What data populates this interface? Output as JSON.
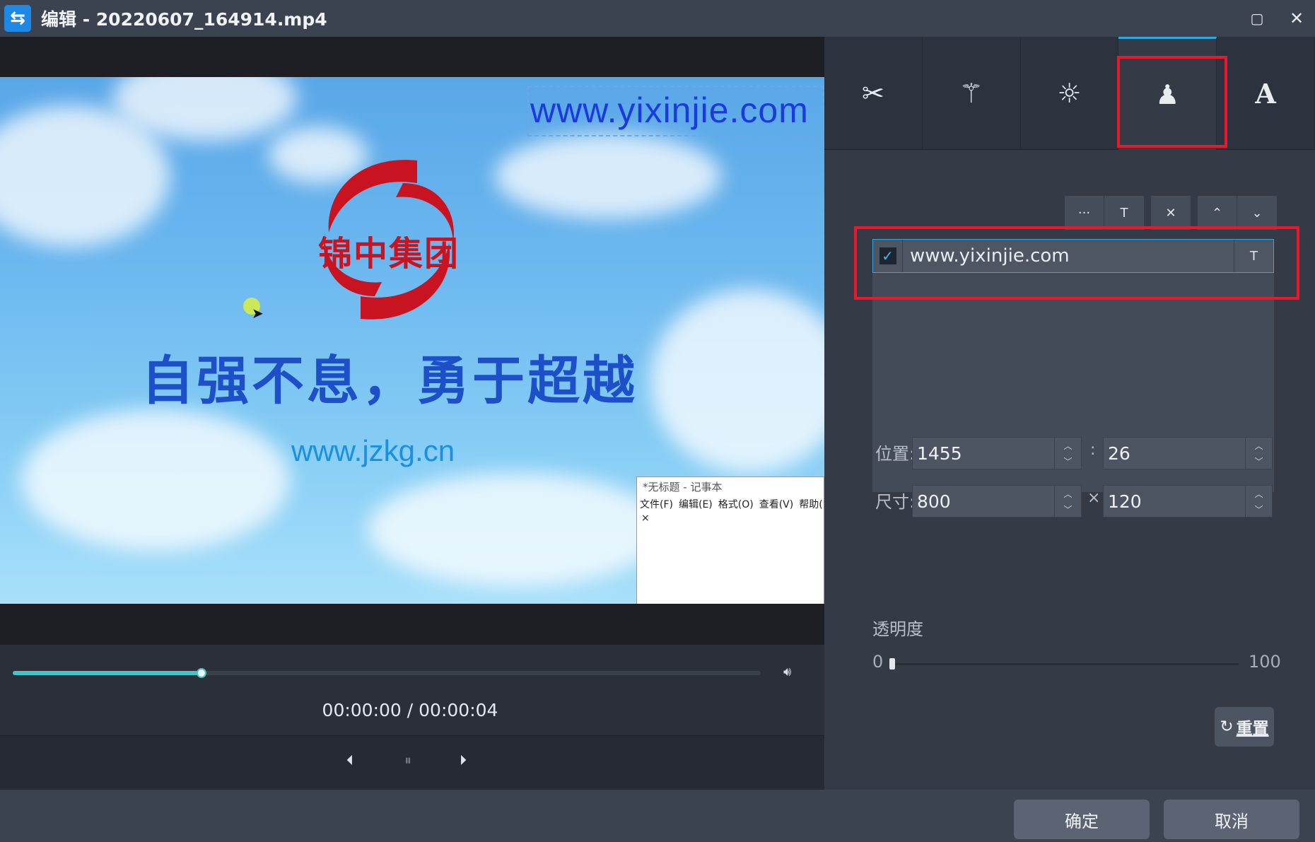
{
  "window": {
    "title": "编辑 - 20220607_164914.mp4",
    "maximize_glyph": "▢",
    "close_glyph": "✕"
  },
  "video": {
    "watermark_text": "www.yixinjie.com",
    "logo_text": "锦中集团",
    "slogan": "自强不息，勇于超越",
    "site_text": "www.jzkg.cn",
    "notepad": {
      "title": "*无标题 - 记事本",
      "menu": [
        "文件(F)",
        "编辑(E)",
        "格式(O)",
        "查看(V)",
        "帮助(H)"
      ],
      "content": "×"
    }
  },
  "player": {
    "progress": 0.252,
    "time": "00:00:00 / 00:00:04",
    "volume_icon": "speaker-icon"
  },
  "tabs": [
    {
      "name": "cut",
      "icon": "scissors-icon",
      "glyph": "✂"
    },
    {
      "name": "effects",
      "icon": "magic-wand-icon",
      "glyph": "⚚"
    },
    {
      "name": "adjust",
      "icon": "brightness-icon",
      "glyph": "☼"
    },
    {
      "name": "watermark",
      "icon": "stamp-icon",
      "glyph": "♟",
      "active": true
    },
    {
      "name": "text",
      "icon": "text-icon",
      "glyph": "A"
    }
  ],
  "toolbar": {
    "more": "···",
    "text": "T",
    "delete": "✕",
    "up": "⌃",
    "down": "⌄"
  },
  "watermarks": [
    {
      "text": "www.yixinjie.com",
      "checked": true,
      "type_glyph": "T"
    }
  ],
  "position": {
    "label": "位置:",
    "x": "1455",
    "y": "26",
    "separator": ":"
  },
  "size": {
    "label": "尺寸:",
    "w": "800",
    "h": "120",
    "separator": "×"
  },
  "opacity": {
    "label": "透明度",
    "min": "0",
    "max": "100",
    "value": 0
  },
  "reset_label": "重置",
  "footer": {
    "confirm": "确定",
    "cancel": "取消"
  },
  "colors": {
    "accent": "#2ea8e0",
    "highlight": "#e8192c",
    "seek": "#47c2c6"
  }
}
